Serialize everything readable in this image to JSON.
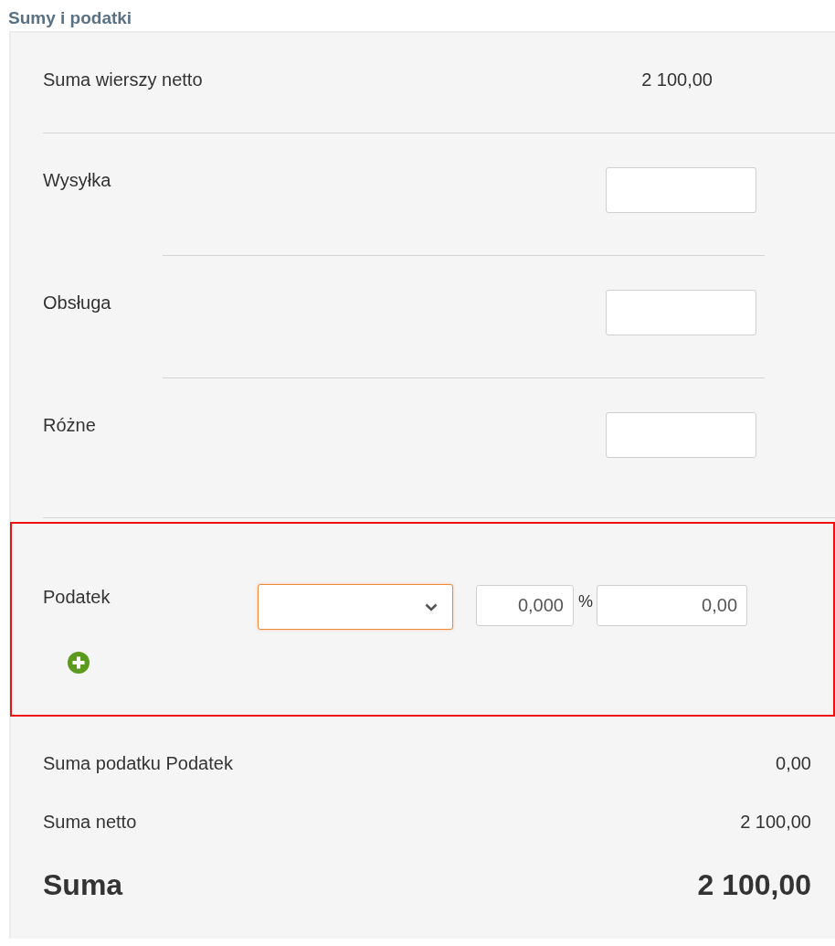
{
  "section_title": "Sumy i podatki",
  "net_lines_total": {
    "label": "Suma wierszy netto",
    "value": "2 100,00"
  },
  "charges": [
    {
      "label": "Wysyłka"
    },
    {
      "label": "Obsługa"
    },
    {
      "label": "Różne"
    }
  ],
  "tax": {
    "label": "Podatek",
    "select": {
      "focused": true
    },
    "rate": "0,000",
    "percent_sign": "%",
    "amount": "0,00"
  },
  "summary": [
    {
      "kind": "normal",
      "label": "Suma podatku Podatek",
      "value": "0,00"
    },
    {
      "kind": "normal",
      "label": "Suma netto",
      "value": "2 100,00"
    },
    {
      "kind": "total",
      "label": "Suma",
      "value": "2 100,00"
    }
  ]
}
